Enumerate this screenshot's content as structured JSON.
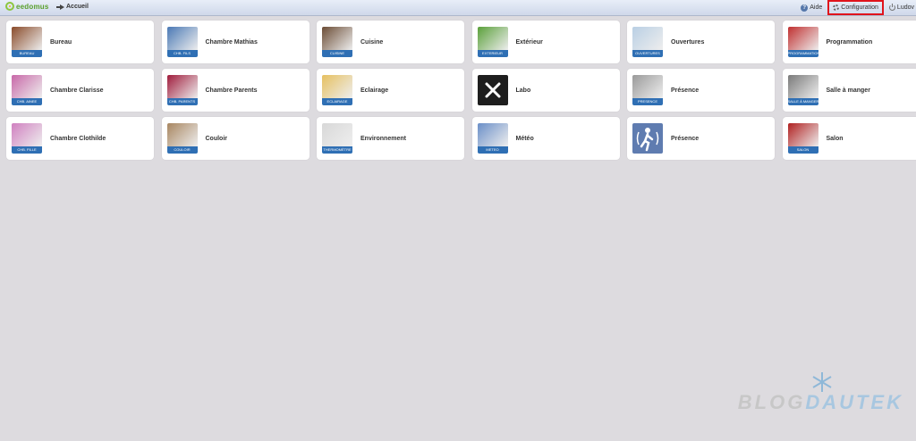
{
  "header": {
    "logo_text": "eedomus",
    "home_label": "Accueil",
    "help_label": "Aide",
    "config_label": "Configuration",
    "user_label": "Ludov"
  },
  "rooms": [
    {
      "label": "Bureau",
      "caption": "BUREAU",
      "icon": "desk-icon",
      "color": "#8a4b2a"
    },
    {
      "label": "Chambre Mathias",
      "caption": "CHB. FILS",
      "icon": "bed-icon",
      "color": "#4a79b5"
    },
    {
      "label": "Cuisine",
      "caption": "CUISINE",
      "icon": "kitchen-icon",
      "color": "#6b4c35"
    },
    {
      "label": "Extérieur",
      "caption": "EXTERIEUR",
      "icon": "tree-icon",
      "color": "#5aa03a"
    },
    {
      "label": "Ouvertures",
      "caption": "OUVERTURES",
      "icon": "window-icon",
      "color": "#b9cfe4"
    },
    {
      "label": "Programmation",
      "caption": "PROGRAMMATION",
      "icon": "calendar-gear-icon",
      "color": "#c03030"
    },
    {
      "label": "Chambre Clarisse",
      "caption": "CHB. AINEE",
      "icon": "bed-icon",
      "color": "#c868a8"
    },
    {
      "label": "Chambre Parents",
      "caption": "CHB. PARENTS",
      "icon": "bed-icon",
      "color": "#a01c3c"
    },
    {
      "label": "Eclairage",
      "caption": "ECLAIRAGE",
      "icon": "bulb-icon",
      "color": "#e6c060"
    },
    {
      "label": "Labo",
      "caption": "",
      "icon": "tools-icon",
      "color": "#1e1e1e"
    },
    {
      "label": "Présence",
      "caption": "PRESENCE",
      "icon": "motion-icon",
      "color": "#9a9a9a"
    },
    {
      "label": "Salle à manger",
      "caption": "SALLE À MANGER",
      "icon": "dining-icon",
      "color": "#7a7a7a"
    },
    {
      "label": "Chambre Clothilde",
      "caption": "CHB. FILLE",
      "icon": "bed-icon",
      "color": "#d080c0"
    },
    {
      "label": "Couloir",
      "caption": "COULOIR",
      "icon": "hallway-icon",
      "color": "#a88660"
    },
    {
      "label": "Environnement",
      "caption": "THERMOMÈTRE",
      "icon": "gauge-icon",
      "color": "#d8d8d8"
    },
    {
      "label": "Météo",
      "caption": "METEO",
      "icon": "weather-icon",
      "color": "#6a8fc8"
    },
    {
      "label": "Présence",
      "caption": "",
      "icon": "person-motion-icon",
      "color": "#5f7cb0"
    },
    {
      "label": "Salon",
      "caption": "SALON",
      "icon": "armchair-icon",
      "color": "#b02020"
    }
  ],
  "watermark": {
    "part1": "BLOG",
    "part2": "DAUTEK"
  }
}
